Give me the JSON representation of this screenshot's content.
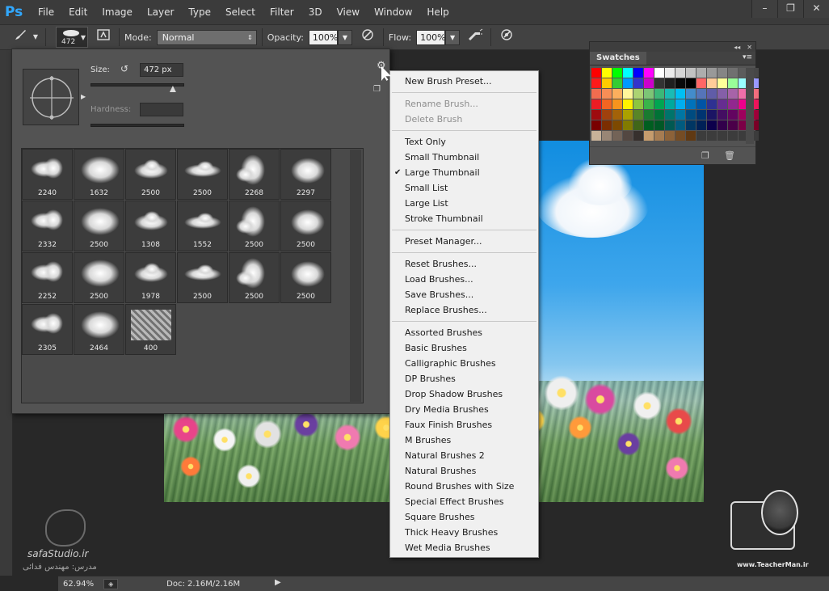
{
  "app": {
    "logo_text": "Ps"
  },
  "menubar": {
    "items": [
      "File",
      "Edit",
      "Image",
      "Layer",
      "Type",
      "Select",
      "Filter",
      "3D",
      "View",
      "Window",
      "Help"
    ]
  },
  "window_controls": {
    "minimize": "–",
    "restore": "❐",
    "close": "✕"
  },
  "options_bar": {
    "brush_size": "472",
    "mode_label": "Mode:",
    "mode_value": "Normal",
    "opacity_label": "Opacity:",
    "opacity_value": "100%",
    "flow_label": "Flow:",
    "flow_value": "100%"
  },
  "brush_panel": {
    "size_label": "Size:",
    "size_value": "472 px",
    "hardness_label": "Hardness:",
    "size_fraction": 0.87,
    "presets": [
      {
        "size": "2240"
      },
      {
        "size": "1632"
      },
      {
        "size": "2500"
      },
      {
        "size": "2500"
      },
      {
        "size": "2268"
      },
      {
        "size": "2297"
      },
      {
        "size": "2332"
      },
      {
        "size": "2500"
      },
      {
        "size": "1308"
      },
      {
        "size": "1552"
      },
      {
        "size": "2500"
      },
      {
        "size": "2500"
      },
      {
        "size": "2252"
      },
      {
        "size": "2500"
      },
      {
        "size": "1978"
      },
      {
        "size": "2500"
      },
      {
        "size": "2500"
      },
      {
        "size": "2500"
      },
      {
        "size": "2305"
      },
      {
        "size": "2464"
      },
      {
        "size": "400"
      }
    ]
  },
  "context_menu": {
    "groups": [
      [
        {
          "label": "New Brush Preset...",
          "disabled": false
        }
      ],
      [
        {
          "label": "Rename Brush...",
          "disabled": true
        },
        {
          "label": "Delete Brush",
          "disabled": true
        }
      ],
      [
        {
          "label": "Text Only",
          "disabled": false
        },
        {
          "label": "Small Thumbnail",
          "disabled": false
        },
        {
          "label": "Large Thumbnail",
          "disabled": false,
          "checked": true
        },
        {
          "label": "Small List",
          "disabled": false
        },
        {
          "label": "Large List",
          "disabled": false
        },
        {
          "label": "Stroke Thumbnail",
          "disabled": false
        }
      ],
      [
        {
          "label": "Preset Manager...",
          "disabled": false
        }
      ],
      [
        {
          "label": "Reset Brushes...",
          "disabled": false
        },
        {
          "label": "Load Brushes...",
          "disabled": false
        },
        {
          "label": "Save Brushes...",
          "disabled": false
        },
        {
          "label": "Replace Brushes...",
          "disabled": false
        }
      ],
      [
        {
          "label": "Assorted Brushes",
          "disabled": false
        },
        {
          "label": "Basic Brushes",
          "disabled": false
        },
        {
          "label": "Calligraphic Brushes",
          "disabled": false
        },
        {
          "label": "DP Brushes",
          "disabled": false
        },
        {
          "label": "Drop Shadow Brushes",
          "disabled": false
        },
        {
          "label": "Dry Media Brushes",
          "disabled": false
        },
        {
          "label": "Faux Finish Brushes",
          "disabled": false
        },
        {
          "label": "M Brushes",
          "disabled": false
        },
        {
          "label": "Natural Brushes 2",
          "disabled": false
        },
        {
          "label": "Natural Brushes",
          "disabled": false
        },
        {
          "label": "Round Brushes with Size",
          "disabled": false
        },
        {
          "label": "Special Effect Brushes",
          "disabled": false
        },
        {
          "label": "Square Brushes",
          "disabled": false
        },
        {
          "label": "Thick Heavy Brushes",
          "disabled": false
        },
        {
          "label": "Wet Media Brushes",
          "disabled": false
        }
      ]
    ],
    "check_glyph": "✔"
  },
  "swatches_panel": {
    "tab_label": "Swatches",
    "colors": [
      "#ff0000",
      "#ffff00",
      "#00ff00",
      "#00ffff",
      "#0000ff",
      "#ff00ff",
      "#ffffff",
      "#ebebeb",
      "#d6d6d6",
      "#c2c2c2",
      "#adadad",
      "#999999",
      "#858585",
      "#707070",
      "#5c5c5c",
      "#474747",
      "#ff1a1a",
      "#ffcc00",
      "#33cc33",
      "#0099ff",
      "#3333cc",
      "#cc00cc",
      "#333333",
      "#1f1f1f",
      "#0a0a0a",
      "#000000",
      "#ff6666",
      "#ffcc99",
      "#ffff99",
      "#99ff99",
      "#99ffff",
      "#9999ff",
      "#f26c4f",
      "#f68e56",
      "#fbaf5d",
      "#fff79a",
      "#acd372",
      "#7cc576",
      "#3bb878",
      "#1abbb4",
      "#00bff3",
      "#438ccb",
      "#5574b9",
      "#605ca8",
      "#855fa8",
      "#a763a8",
      "#f06ea9",
      "#f26d7d",
      "#ed1c24",
      "#f26522",
      "#f7941d",
      "#fff200",
      "#8dc63f",
      "#39b54a",
      "#00a651",
      "#00a99d",
      "#00aeef",
      "#0072bc",
      "#0054a6",
      "#2e3192",
      "#662d91",
      "#92278f",
      "#ec008c",
      "#ed145b",
      "#9e0b0f",
      "#a0410d",
      "#a36209",
      "#aba000",
      "#598527",
      "#1a7b30",
      "#007236",
      "#00746b",
      "#0076a3",
      "#004b80",
      "#003471",
      "#1b1464",
      "#440e62",
      "#630460",
      "#9e005d",
      "#9e0039",
      "#790000",
      "#7b2e00",
      "#7d4900",
      "#827b00",
      "#406618",
      "#005e20",
      "#005826",
      "#005952",
      "#005b7f",
      "#003663",
      "#002157",
      "#0d004c",
      "#32004b",
      "#4b0049",
      "#7b0046",
      "#7a0026",
      "#c7b299",
      "#998675",
      "#736357",
      "#534741",
      "#37302d",
      "#c69c6d",
      "#a67c52",
      "#8c6239",
      "#754c24",
      "#603913",
      "#3c3c3c",
      "#3c3c3c",
      "#3c3c3c",
      "#3c3c3c",
      "#3c3c3c",
      "#3c3c3c"
    ]
  },
  "status_bar": {
    "zoom": "62.94%",
    "doc": "Doc: 2.16M/2.16M"
  },
  "watermarks": {
    "left_brand": "safaStudio.ir",
    "left_sub": "مدرس: مهندس فدائی",
    "right_url": "www.TeacherMan.ir"
  },
  "icons": {
    "brush": "brush-icon",
    "gear": "gear-icon",
    "airbrush": "airbrush-icon",
    "pressure": "pressure-icon"
  }
}
